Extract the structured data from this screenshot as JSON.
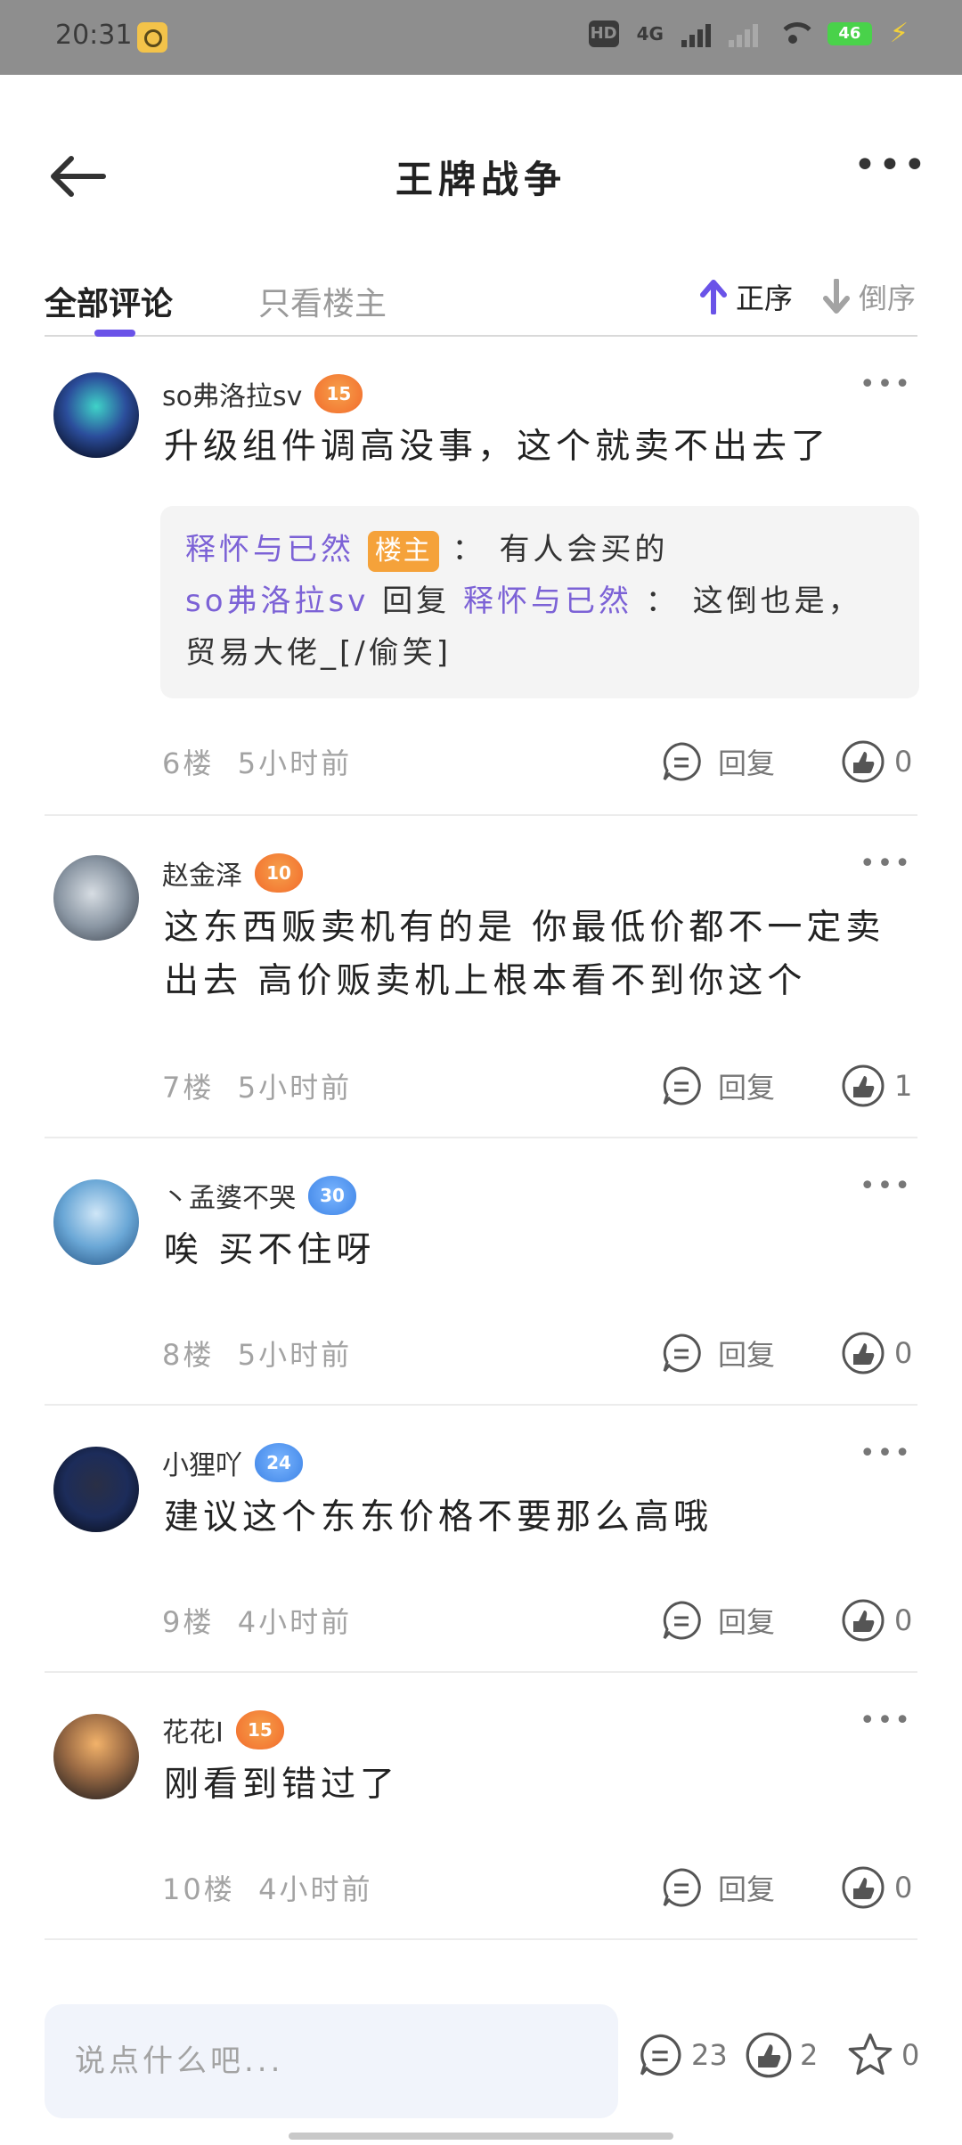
{
  "status_bar": {
    "time": "20:31",
    "hd": "HD",
    "network": "4G",
    "battery": "46"
  },
  "header": {
    "title": "王牌战争"
  },
  "tabs": {
    "all": "全部评论",
    "op_only": "只看楼主",
    "asc": "正序",
    "desc": "倒序"
  },
  "comments": [
    {
      "user": "so弗洛拉sv",
      "level": "15",
      "level_color": "orange",
      "content": "升级组件调高没事，这个就卖不出去了",
      "reply": {
        "line1_name": "释怀与已然",
        "line1_tag": "楼主",
        "line1_sep": "：",
        "line1_text": "有人会买的",
        "line2_name": "so弗洛拉sv",
        "line2_mid": "回复",
        "line2_target": "释怀与已然",
        "line2_sep": "：",
        "line2_text": "这倒也是，贸易大佬_[/偷笑]"
      },
      "floor": "6楼",
      "time": "5小时前",
      "reply_label": "回复",
      "likes": "0"
    },
    {
      "user": "赵金泽",
      "level": "10",
      "level_color": "orange",
      "content": "这东西贩卖机有的是 你最低价都不一定卖出去 高价贩卖机上根本看不到你这个",
      "floor": "7楼",
      "time": "5小时前",
      "reply_label": "回复",
      "likes": "1"
    },
    {
      "user": "丶孟婆不哭",
      "level": "30",
      "level_color": "blue",
      "content": "唉  买不住呀",
      "floor": "8楼",
      "time": "5小时前",
      "reply_label": "回复",
      "likes": "0"
    },
    {
      "user": "小狸吖",
      "level": "24",
      "level_color": "blue",
      "content": "建议这个东东价格不要那么高哦",
      "floor": "9楼",
      "time": "4小时前",
      "reply_label": "回复",
      "likes": "0"
    },
    {
      "user": "花花I",
      "level": "15",
      "level_color": "orange",
      "content": "刚看到错过了",
      "floor": "10楼",
      "time": "4小时前",
      "reply_label": "回复",
      "likes": "0"
    }
  ],
  "bottom_bar": {
    "placeholder": "说点什么吧...",
    "comments": "23",
    "likes": "2",
    "favorites": "0"
  },
  "colors": {
    "accent": "#6a53e8",
    "name": "#7c62d6",
    "op_tag": "#f5a23a"
  }
}
